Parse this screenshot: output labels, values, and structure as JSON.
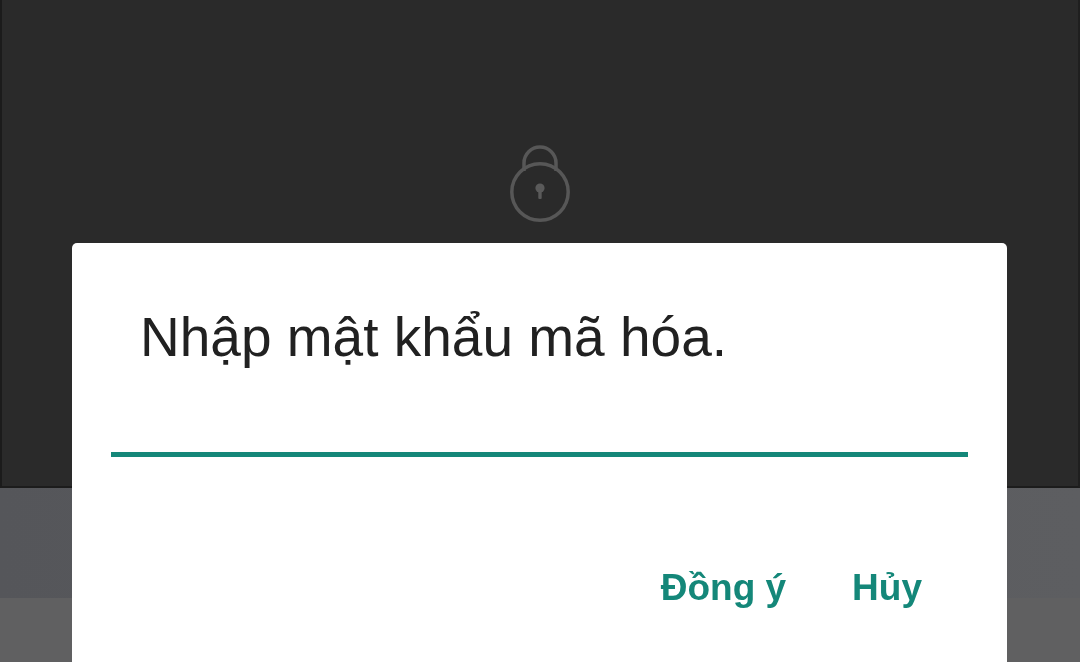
{
  "dialog": {
    "title": "Nhập mật khẩu mã hóa.",
    "password_field": {
      "focused": true
    },
    "buttons": [
      {
        "label": "Đồng ý"
      },
      {
        "label": "Hủy"
      }
    ]
  }
}
